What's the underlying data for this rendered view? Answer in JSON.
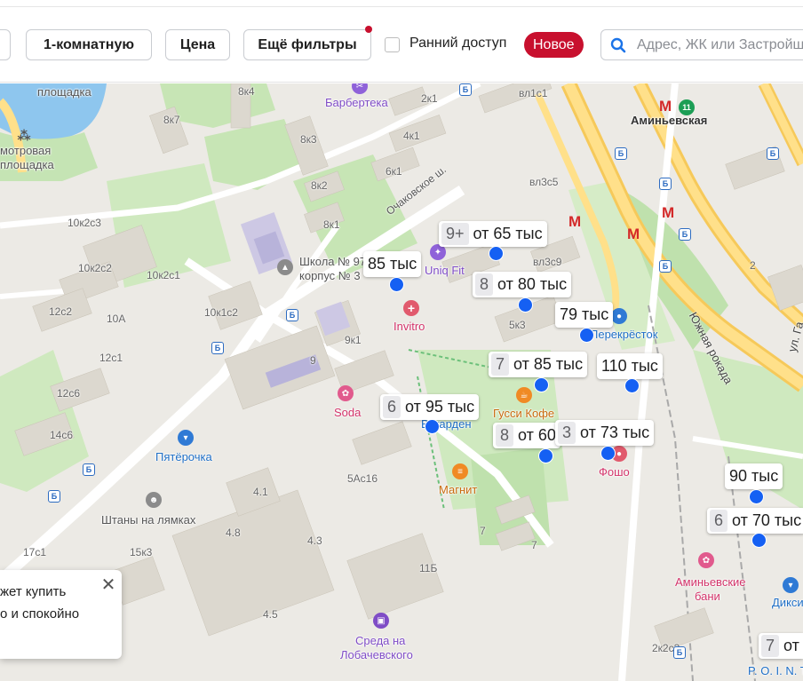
{
  "filters": {
    "rooms_label": "1-комнатную",
    "price_label": "Цена",
    "more_filters_label": "Ещё фильтры",
    "early_access_label": "Ранний доступ",
    "new_badge": "Новое",
    "search_placeholder": "Адрес, ЖК или Застройщик"
  },
  "map": {
    "street_labels": {
      "ochakovskoe": "Очаковское ш.",
      "yuzhnaya_rokada": "Южная рокада",
      "ul_ga": "ул. Га"
    },
    "building_labels": [
      "8к4",
      "8к7",
      "2к1",
      "вл1с1",
      "8к3",
      "4к1",
      "6к1",
      "8к2",
      "вл3с5",
      "8к1",
      "10к2с3",
      "10к2с2",
      "10к2с1",
      "12с2",
      "10А",
      "10к1с2",
      "12с1",
      "9к1",
      "9",
      "5к3",
      "12с6",
      "14с6",
      "5Ас16",
      "4.1",
      "4.8",
      "4.3",
      "11Б",
      "4.5",
      "17с1",
      "15к3",
      "2к2с3",
      "7",
      "7",
      "2",
      "вл3с9"
    ],
    "pois": {
      "park1": "площадка",
      "park2": "мотровая",
      "park3": "площадка",
      "barbertka": "Барбертека",
      "school1": "Школа № 97",
      "school2": "корпус № 3",
      "uniq": "Uniq Fit",
      "invitro": "Invitro",
      "perekrestok": "Перекрёсток",
      "soda": "Soda",
      "gussi": "Гусси Кофе",
      "gardens": "Вегарден",
      "fosho": "Фошо",
      "magnit": "Магнит",
      "pyaterochka": "Пятёрочка",
      "shtany": "Штаны на лямках",
      "aminevskaya": "Аминьевская",
      "aminevskie_bani1": "Аминьевские",
      "aminevskie_bani2": "бани",
      "diksi": "Дикси",
      "sreda1": "Среда на",
      "sreda2": "Лобачевского",
      "poin": "P. O. I. N. T"
    },
    "price_tags": [
      {
        "count": "9+",
        "price": "от 65 тыс"
      },
      {
        "count": "",
        "price": "85 тыс"
      },
      {
        "count": "8",
        "price": "от 80 тыс"
      },
      {
        "count": "",
        "price": "79 тыс"
      },
      {
        "count": "7",
        "price": "от 85 тыс"
      },
      {
        "count": "",
        "price": "110 тыс"
      },
      {
        "count": "6",
        "price": "от 95 тыс"
      },
      {
        "count": "8",
        "price": "от 60 тыс"
      },
      {
        "count": "3",
        "price": "от 73 тыс"
      },
      {
        "count": "",
        "price": "90 тыс"
      },
      {
        "count": "6",
        "price": "от 70 тыс"
      },
      {
        "count": "7",
        "price": "от 7"
      }
    ]
  },
  "popup": {
    "line1": "жет купить",
    "line2": "о и спокойно"
  },
  "colors": {
    "accent_red": "#c8102e",
    "marker_blue": "#1560f3",
    "search_icon_blue": "#1a73e8"
  }
}
